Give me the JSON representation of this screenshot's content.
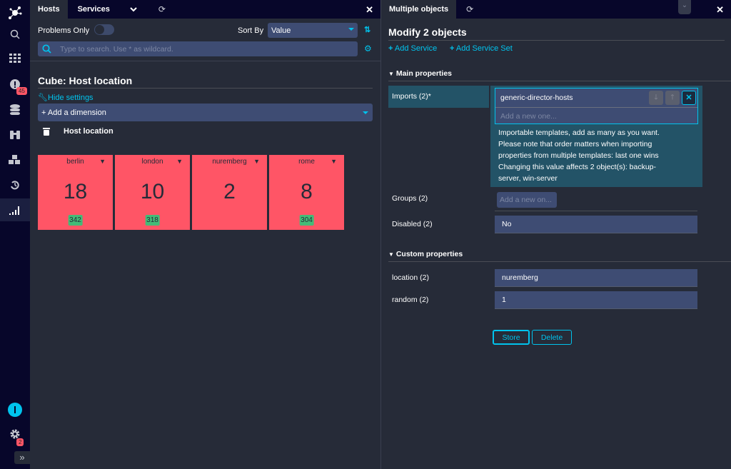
{
  "sidebar": {
    "items": [
      {
        "name": "logo",
        "icon": "logo-icon"
      },
      {
        "name": "search",
        "icon": "search-icon"
      },
      {
        "name": "dashboard",
        "icon": "grid-icon"
      },
      {
        "name": "problems",
        "icon": "exclamation-icon",
        "badge": "45"
      },
      {
        "name": "overview",
        "icon": "database-icon"
      },
      {
        "name": "history",
        "icon": "binoculars-icon"
      },
      {
        "name": "configuration",
        "icon": "cubes-icon"
      },
      {
        "name": "history2",
        "icon": "history-icon"
      },
      {
        "name": "reporting",
        "icon": "signal-icon"
      }
    ],
    "bottom": {
      "user_icon": "user-icon",
      "settings_badge": "2",
      "expand_label": "»"
    }
  },
  "left": {
    "tabs": [
      "Hosts",
      "Services"
    ],
    "problems_only_label": "Problems Only",
    "sort_by_label": "Sort By",
    "sort_value": "Value",
    "search_placeholder": "Type to search. Use * as wildcard.",
    "cube_title": "Cube: Host location",
    "hide_settings": "Hide settings",
    "add_dimension": "+ Add a dimension",
    "dimension": "Host location",
    "tiles": [
      {
        "name": "berlin",
        "count": "18",
        "badge": "342"
      },
      {
        "name": "london",
        "count": "10",
        "badge": "318"
      },
      {
        "name": "nuremberg",
        "count": "2",
        "badge": ""
      },
      {
        "name": "rome",
        "count": "8",
        "badge": "304"
      }
    ]
  },
  "right": {
    "tab": "Multiple objects",
    "title": "Modify 2 objects",
    "add_service": "Add Service",
    "add_service_set": "Add Service Set",
    "main_properties": "Main properties",
    "imports_label": "Imports (2)*",
    "imports_value": "generic-director-hosts",
    "imports_placeholder": "Add a new one...",
    "imports_help": [
      "Importable templates, add as many as you want.",
      "Please note that order matters when importing",
      "properties from multiple templates: last one wins",
      "Changing this value affects 2 object(s): backup-",
      "server, win-server"
    ],
    "groups_label": "Groups (2)",
    "groups_placeholder": "Add a new on...",
    "disabled_label": "Disabled (2)",
    "disabled_value": "No",
    "custom_properties": "Custom properties",
    "location_label": "location (2)",
    "location_value": "nuremberg",
    "random_label": "random (2)",
    "random_value": "1",
    "store": "Store",
    "delete": "Delete"
  }
}
